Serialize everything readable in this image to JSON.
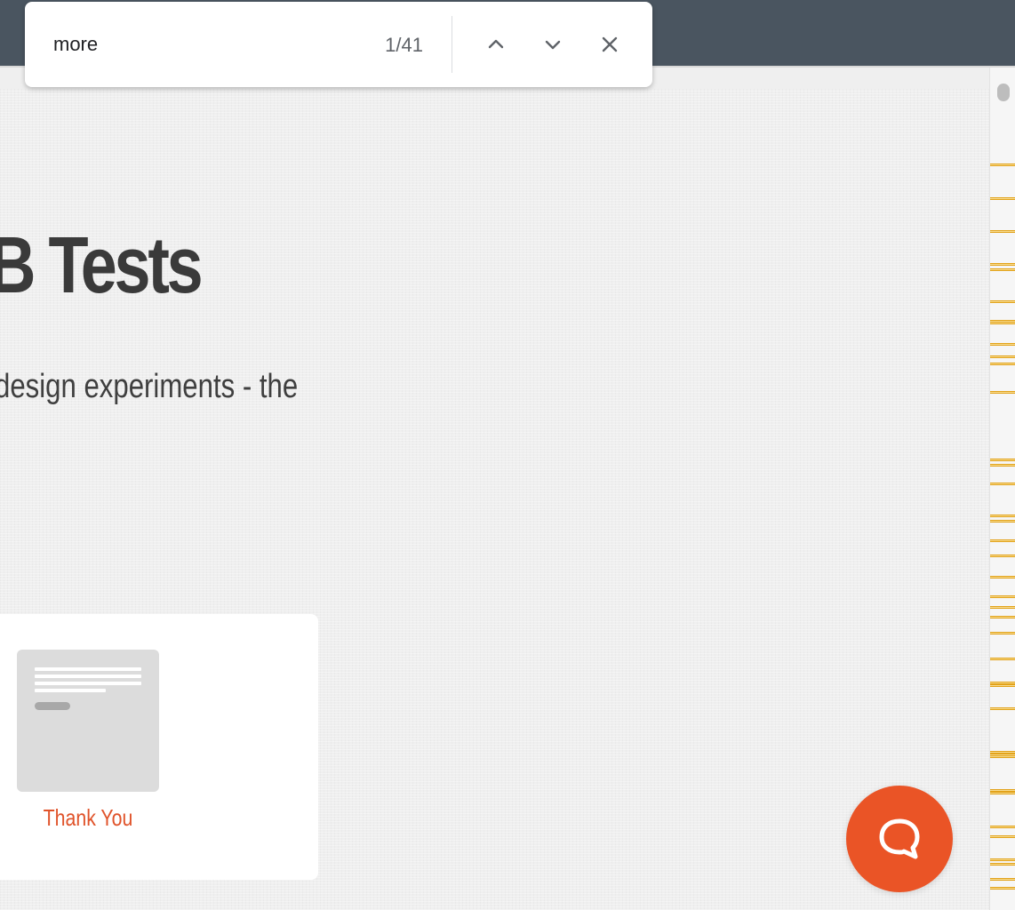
{
  "find_bar": {
    "query": "more",
    "match_count": "1/41",
    "icons": {
      "previous": "chevron-up-icon",
      "next": "chevron-down-icon",
      "close": "close-icon"
    }
  },
  "page": {
    "headline": "/B Tests",
    "subtext": "design experiments - the",
    "card": {
      "label": "Thank You"
    }
  },
  "chat": {
    "icon": "chat-bubble-icon"
  },
  "colors": {
    "topbar": "#4a5560",
    "accent": "#ea5426",
    "card_label": "#e0532a",
    "match_marker": "#e2a21a"
  }
}
